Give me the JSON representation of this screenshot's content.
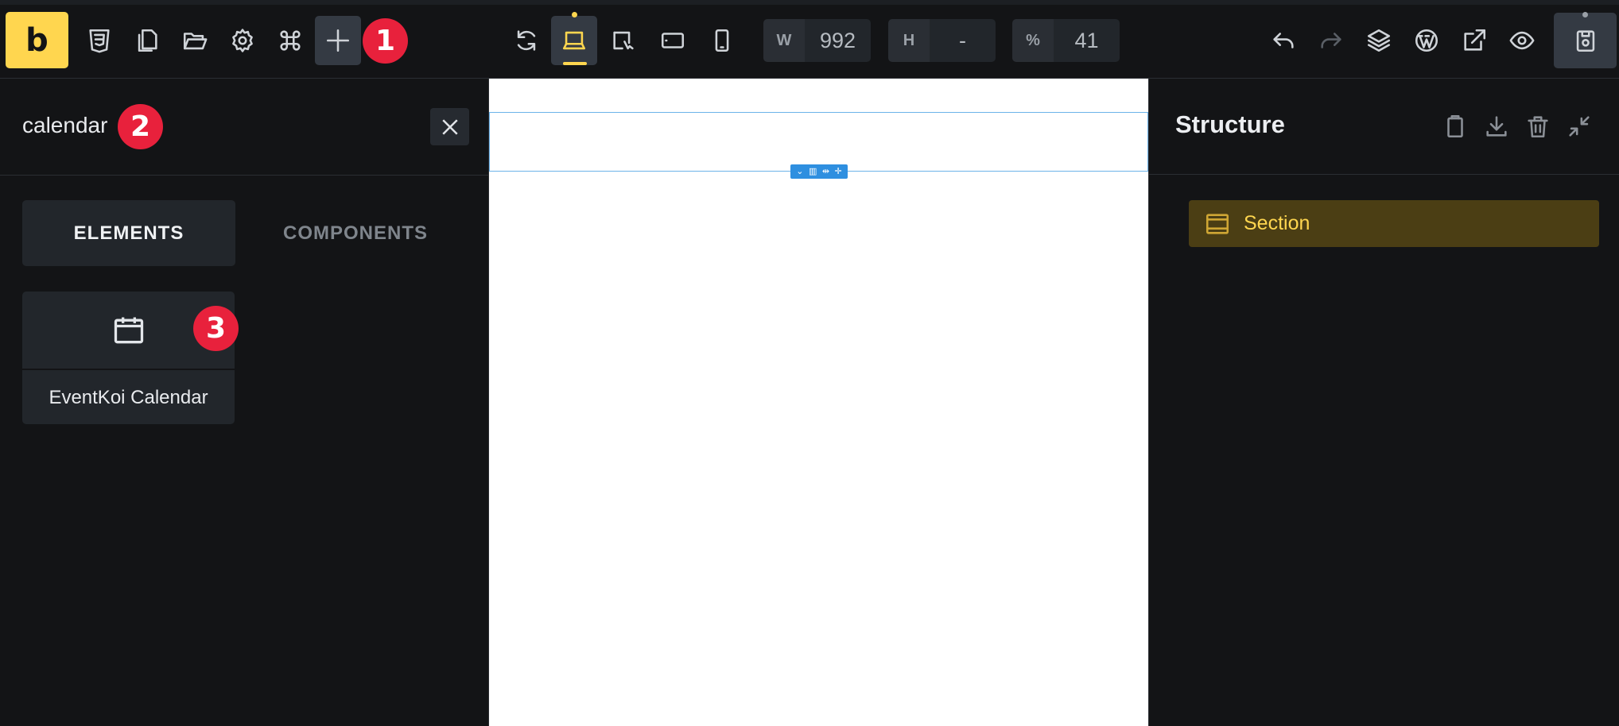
{
  "toolbar": {
    "logo_text": "b",
    "icons_left": [
      "css3-icon",
      "pages-icon",
      "folder-open-icon",
      "settings-gear-icon",
      "command-icon",
      "plus-add-icon"
    ],
    "icons_center": [
      "refresh-icon",
      "laptop-icon",
      "tablet-landscape-icon",
      "tablet-icon",
      "phone-icon"
    ],
    "width_label": "W",
    "width_value": "992",
    "height_label": "H",
    "height_value": "-",
    "zoom_label": "%",
    "zoom_value": "41",
    "icons_right": [
      "undo-icon",
      "redo-icon",
      "layers-icon",
      "wordpress-icon",
      "external-link-icon",
      "preview-eye-icon",
      "save-icon"
    ],
    "accent_color": "#ffd64f"
  },
  "annotations": [
    "1",
    "2",
    "3"
  ],
  "left_panel": {
    "search_value": "calendar",
    "tabs": [
      "ELEMENTS",
      "COMPONENTS"
    ],
    "elements": [
      {
        "label": "EventKoi Calendar",
        "icon": "calendar-icon"
      }
    ]
  },
  "canvas": {
    "section_toolbar_icons": [
      "chevron-down-icon",
      "columns-icon",
      "move-horizontal-icon",
      "move-icon"
    ],
    "selection_color": "#2e8fe0"
  },
  "structure_panel": {
    "title": "Structure",
    "header_icons": [
      "clipboard-icon",
      "download-icon",
      "trash-icon",
      "collapse-icon"
    ],
    "items": [
      {
        "label": "Section",
        "icon": "section-icon"
      }
    ]
  }
}
